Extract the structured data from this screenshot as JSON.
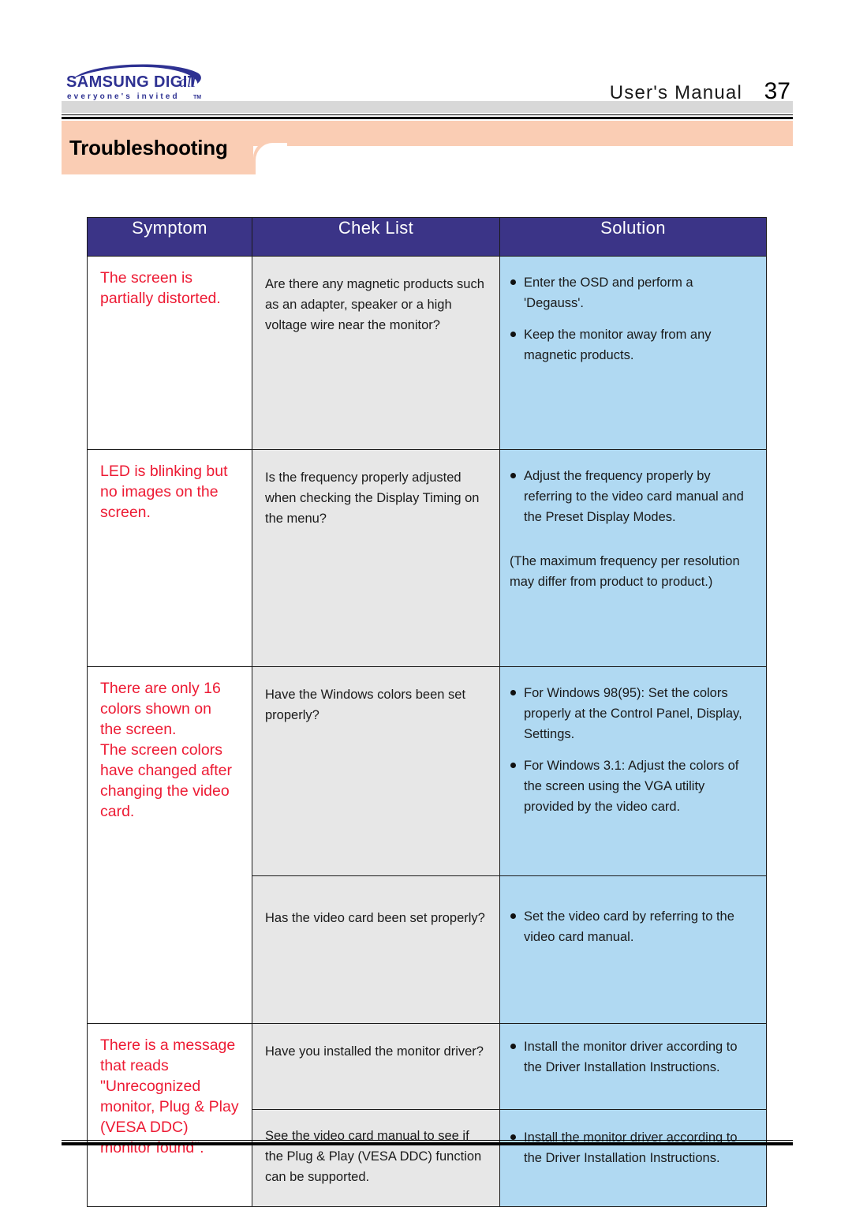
{
  "header": {
    "logo_primary": "SAMSUNG DIGITall",
    "logo_tagline": "everyone's invited™",
    "manual_label": "User's Manual",
    "page_number": "37"
  },
  "section": {
    "title": "Troubleshooting"
  },
  "table": {
    "columns": [
      "Symptom",
      "Chek List",
      "Solution"
    ],
    "rows": [
      {
        "symptom": "The screen is partially distorted.",
        "symptom_lines": [
          "The screen is",
          "partially distorted."
        ],
        "subrows": [
          {
            "check": "Are there any magnetic products such as an adapter, speaker or a high voltage wire near the monitor?",
            "solution_bullets": [
              "Enter the OSD and perform a 'Degauss'.",
              "Keep the monitor away from any magnetic products."
            ],
            "solution_note": ""
          }
        ]
      },
      {
        "symptom": "LED is blinking but no images on the screen.",
        "symptom_lines": [
          "LED is blinking but",
          "no images on the",
          "screen."
        ],
        "subrows": [
          {
            "check": "Is the frequency properly adjusted when checking the Display Timing on the menu?",
            "solution_bullets": [
              "Adjust the frequency properly by referring to the video card manual and the Preset Display Modes."
            ],
            "solution_note": "(The maximum frequency per resolution may differ from product to product.)"
          }
        ]
      },
      {
        "symptom": "There are only 16 colors shown on the screen. The screen colors have changed after changing the video card.",
        "symptom_lines": [
          "There are only 16",
          "colors shown on",
          "the screen.",
          "The screen colors",
          "have changed after",
          "changing the video",
          "card."
        ],
        "subrows": [
          {
            "check": "Have the Windows colors been set properly?",
            "solution_bullets": [
              "For Windows 98(95): Set the colors properly at the Control Panel, Display, Settings.",
              "For Windows 3.1: Adjust the colors of the screen using the VGA utility provided by the video card."
            ],
            "solution_note": ""
          },
          {
            "check": "Has the video card been set properly?",
            "solution_bullets": [
              "Set the video card by referring to the video card manual."
            ],
            "solution_note": ""
          }
        ]
      },
      {
        "symptom": "There is a message that reads \"Unrecognized monitor, Plug & Play (VESA DDC) monitor found\".",
        "symptom_lines": [
          "There is a message",
          "that reads",
          "\"Unrecognized",
          "monitor, Plug & Play",
          "(VESA DDC)",
          "monitor found\"."
        ],
        "subrows": [
          {
            "check": "Have you installed the monitor driver?",
            "solution_bullets": [
              "Install the monitor driver according to the Driver Installation Instructions."
            ],
            "solution_note": ""
          },
          {
            "check": "See the video card manual to see if the Plug & Play (VESA DDC) function can be supported.",
            "solution_bullets": [
              "Install the monitor driver according to the Driver Installation Instructions."
            ],
            "solution_note": ""
          }
        ]
      }
    ]
  },
  "colors": {
    "header_navy": "#3b3487",
    "symptom_red": "#ed1b34",
    "check_gray": "#e7e7e7",
    "solution_blue": "#b0d9f2",
    "peach": "#facdb4",
    "logo_blue": "#2e3192"
  }
}
